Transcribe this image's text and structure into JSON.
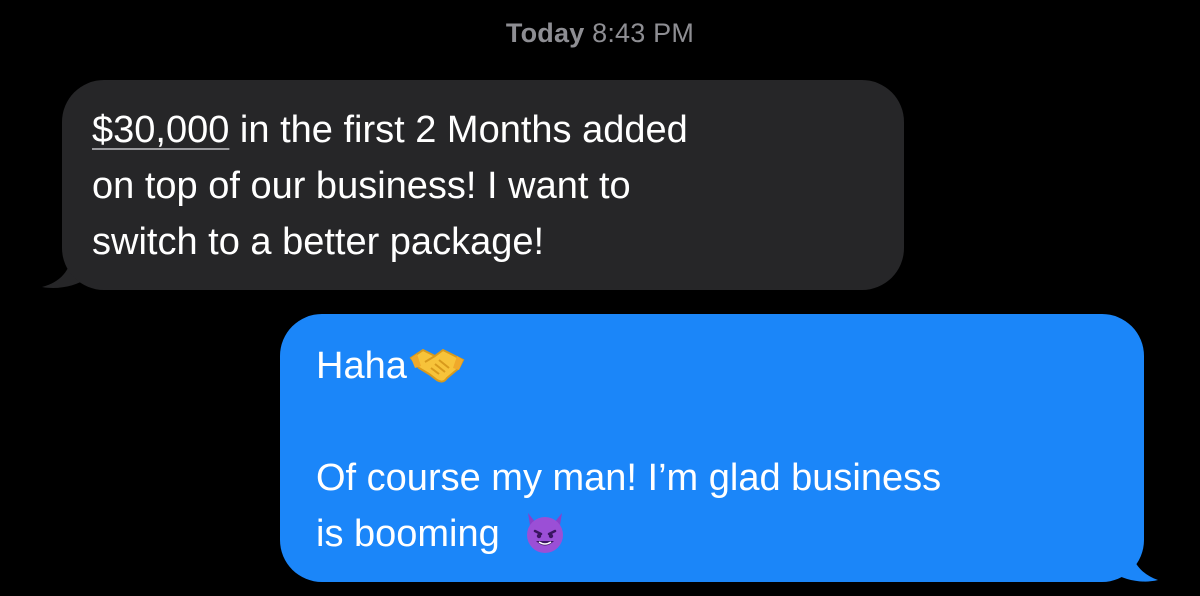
{
  "header": {
    "timestamp_day": "Today",
    "timestamp_time": "8:43 PM"
  },
  "messages": {
    "received": {
      "amount": "$30,000",
      "line1_rest": " in the first 2 Months added",
      "line2": "on top of our business! I want to",
      "line3": "switch to a better package!"
    },
    "sent": {
      "line1": "Haha",
      "line1_emoji": "handshake-emoji",
      "line2": "Of course my man! I’m glad business",
      "line3": "is booming",
      "line3_emoji": "smiling-devil-emoji"
    }
  },
  "colors": {
    "background": "#000000",
    "received_bubble": "#262628",
    "sent_bubble": "#1b86f9",
    "timestamp": "#8e8e93",
    "text": "#ffffff"
  }
}
